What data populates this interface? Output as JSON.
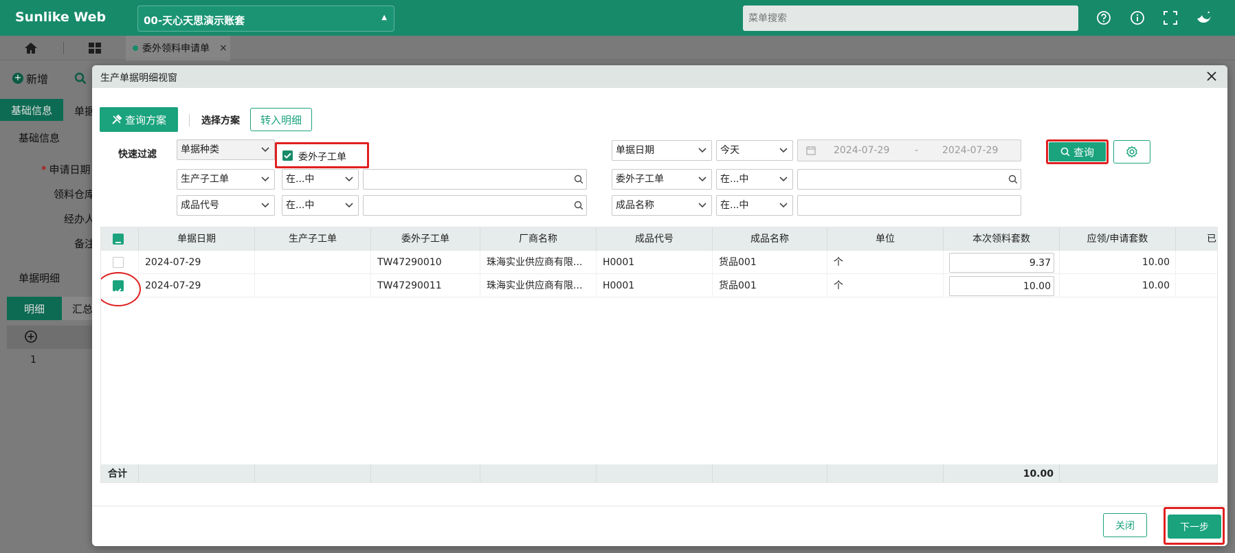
{
  "header": {
    "brand": "Sunlike Web",
    "account": "00-天心天思演示账套",
    "menu_search_placeholder": "菜单搜索",
    "icons": [
      "help-icon",
      "info-icon",
      "fullscreen-icon",
      "bird-icon"
    ]
  },
  "tabs": {
    "doc_tab_label": "委外领料申请单"
  },
  "background": {
    "new_label": "新增",
    "tab_basic": "基础信息",
    "tab_doc": "单据",
    "section_basic": "基础信息",
    "labels": [
      "申请日期",
      "领料仓库",
      "经办人",
      "备注"
    ],
    "section_detail": "单据明细",
    "subtab_detail": "明细",
    "subtab_summary": "汇总",
    "row_number": "1"
  },
  "modal": {
    "title": "生产单据明细视窗",
    "scheme_button": "查询方案",
    "scheme_label": "选择方案",
    "transfer_button": "转入明细",
    "quick_filter_label": "快速过滤",
    "filters": {
      "doc_type": "单据种类",
      "subcontract_checkbox_label": "委外子工单",
      "subcontract_checked": true,
      "date_field": "单据日期",
      "date_preset": "今天",
      "date_from": "2024-07-29",
      "date_dash": "-",
      "date_to": "2024-07-29",
      "row2_field_a": "生产子工单",
      "row2_op_a": "在...中",
      "row2_value_a": "",
      "row2_field_b": "委外子工单",
      "row2_op_b": "在...中",
      "row2_value_b": "",
      "row3_field_a": "成品代号",
      "row3_op_a": "在...中",
      "row3_value_a": "",
      "row3_field_b": "成品名称",
      "row3_op_b": "在...中",
      "row3_value_b": ""
    },
    "query_button": "查询",
    "grid": {
      "columns": [
        "单据日期",
        "生产子工单",
        "委外子工单",
        "厂商名称",
        "成品代号",
        "成品名称",
        "单位",
        "本次领料套数",
        "应领/申请套数",
        "已"
      ],
      "rows": [
        {
          "checked": false,
          "date": "2024-07-29",
          "prod_order": "",
          "sub_order": "TW47290010",
          "vendor": "珠海实业供应商有限...",
          "product_code": "H0001",
          "product_name": "货品001",
          "unit": "个",
          "qty_this": "9.37",
          "qty_req": "10.00"
        },
        {
          "checked": true,
          "date": "2024-07-29",
          "prod_order": "",
          "sub_order": "TW47290011",
          "vendor": "珠海实业供应商有限...",
          "product_code": "H0001",
          "product_name": "货品001",
          "unit": "个",
          "qty_this": "10.00",
          "qty_req": "10.00"
        }
      ],
      "footer_label": "合计",
      "footer_total": "10.00",
      "scroll_fraction": 0.69
    },
    "close_button": "关闭",
    "next_button": "下一步"
  },
  "colors": {
    "header_bg": "#178a6a",
    "accent": "#1aa37d",
    "highlight": "#e02020"
  }
}
